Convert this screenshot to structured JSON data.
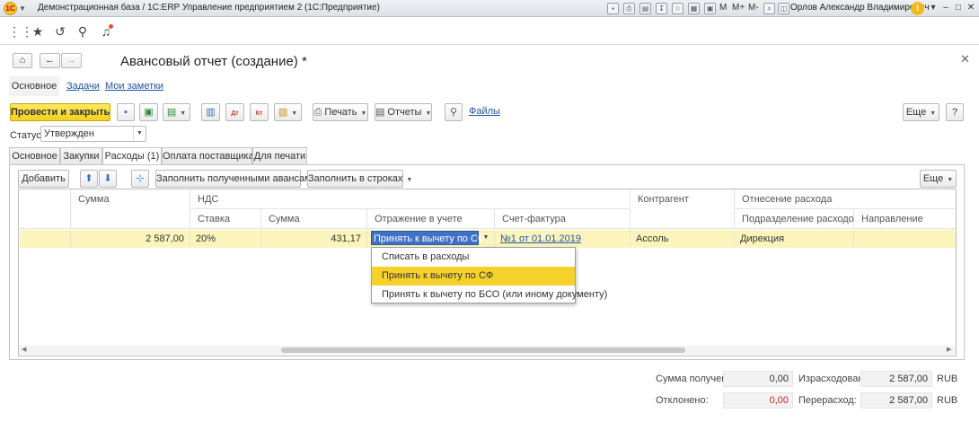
{
  "window": {
    "title": "Демонстрационная база / 1С:ERP Управление предприятием 2  (1С:Предприятие)",
    "user": "Орлов Александр Владимирович",
    "memory_buttons": [
      "M",
      "M+",
      "M-"
    ]
  },
  "form": {
    "title": "Авансовый отчет (создание) *",
    "tabs": [
      "Основное",
      "Задачи",
      "Мои заметки"
    ]
  },
  "toolbar": {
    "post_close": "Провести и закрыть",
    "print": "Печать",
    "reports": "Отчеты",
    "files": "Файлы",
    "more": "Еще",
    "help": "?"
  },
  "status": {
    "label": "Статус:",
    "value": "Утвержден"
  },
  "inner_tabs": [
    "Основное",
    "Закупки",
    "Расходы (1)",
    "Оплата поставщикам",
    "Для печати"
  ],
  "tab_toolbar": {
    "add": "Добавить",
    "fill_advances": "Заполнить полученными авансами",
    "fill_rows": "Заполнить в строках",
    "more": "Еще"
  },
  "grid": {
    "headers": {
      "sum": "Сумма",
      "vat": "НДС",
      "rate": "Ставка",
      "vat_sum": "Сумма",
      "accounting": "Отражение в учете",
      "invoice": "Счет-фактура",
      "counterparty": "Контрагент",
      "expense_attr": "Отнесение расхода",
      "department": "Подразделение расходов",
      "direction": "Направление"
    },
    "row": {
      "sum": "2 587,00",
      "rate": "20%",
      "vat_sum": "431,17",
      "accounting": "Принять к вычету по СФ",
      "invoice": "№1 от 01.01.2019",
      "counterparty": "Ассоль",
      "department": "Дирекция",
      "direction": ""
    },
    "dropdown_options": [
      "Списать в расходы",
      "Принять к вычету по СФ",
      "Принять к вычету по БСО (или иному документу)"
    ],
    "selected_option_index": 1
  },
  "footer": {
    "received_label": "Сумма получено:",
    "received_value": "0,00",
    "rejected_label": "Отклонено:",
    "rejected_value": "0,00",
    "spent_label": "Израсходовано:",
    "spent_value": "2 587,00",
    "overspent_label": "Перерасход:",
    "overspent_value": "2 587,00",
    "currency": "RUB"
  },
  "colors": {
    "primary_button": "#f2d21f",
    "active_row": "#fbf5bd",
    "selected_option": "#f6d12a",
    "link": "#2453a0",
    "negative_value": "#d22222"
  }
}
